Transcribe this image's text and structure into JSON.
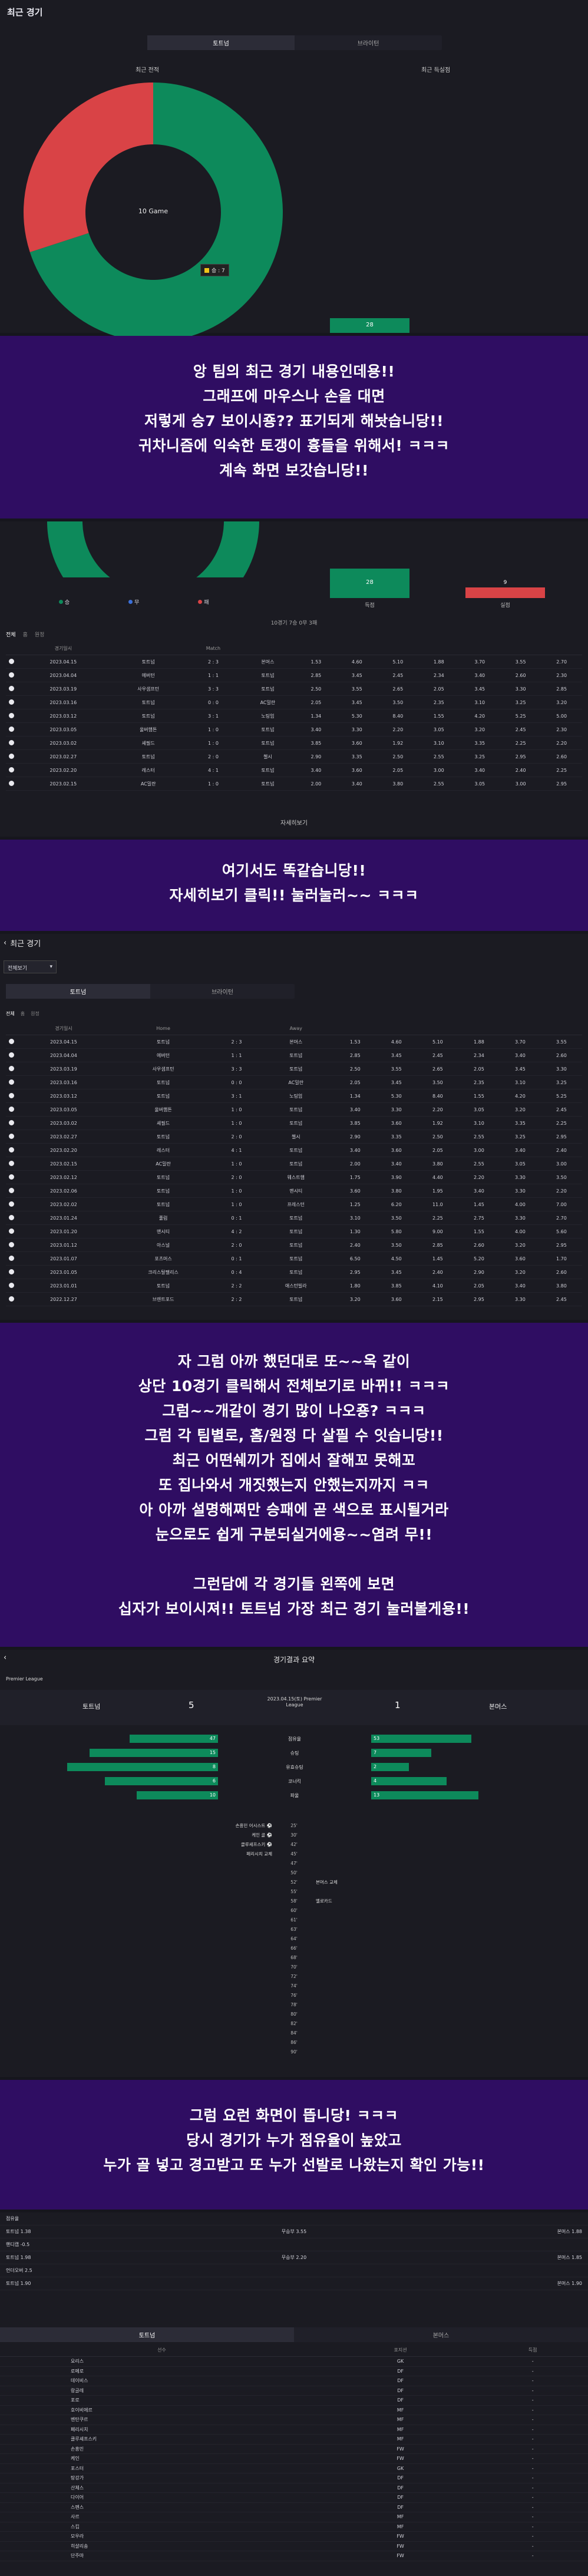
{
  "section1": {
    "title": "최근 경기",
    "tabs": [
      "토트넘",
      "브라이턴"
    ],
    "donut_left_label": "최근 전적",
    "donut_right_label": "최근 득실점",
    "donut_center": "10 Game",
    "legend_chip": "승 : 7",
    "bar_value": "28"
  },
  "chart_data": {
    "type": "pie",
    "categories": [
      "승",
      "패"
    ],
    "values": [
      7,
      3
    ],
    "title": "",
    "center_label": "10 Game",
    "legend_placement": "bottom"
  },
  "colors": {
    "green": "#0d8a5b",
    "red": "#d94346",
    "purple": "#2f0d62",
    "bg": "#16161d"
  },
  "caption1": [
    "앙 팀의 최근 경기 내용인데용!!",
    "그래프에 마우스나 손을 대면",
    "저렇게 승7 보이시죵?? 표기되게 해놧습니당!!",
    "귀차니즘에 익숙한 토갱이 흉들을 위해서! ㅋㅋㅋ",
    "계속 화면 보갓습니당!!"
  ],
  "section2": {
    "legend": [
      "승",
      "무",
      "패"
    ],
    "goals_value": "28",
    "conceded_value": "9",
    "goals_label": "득점",
    "conceded_label": "실점",
    "summary": "10경기 7승 0무 3패",
    "filter": [
      "전체",
      "홈",
      "원정"
    ],
    "headers": [
      "경기일시",
      "",
      "Match",
      "",
      "",
      "",
      "",
      "",
      "",
      "",
      ""
    ],
    "rows": [
      [
        "2023.04.15",
        "토트넘",
        "2 : 3",
        "본머스",
        "1.53",
        "4.60",
        "5.10",
        "1.88",
        "3.70",
        "3.55",
        "2.70"
      ],
      [
        "2023.04.04",
        "에버턴",
        "1 : 1",
        "토트넘",
        "2.85",
        "3.45",
        "2.45",
        "2.34",
        "3.40",
        "2.60",
        "2.30"
      ],
      [
        "2023.03.19",
        "사우샘프턴",
        "3 : 3",
        "토트넘",
        "2.50",
        "3.55",
        "2.65",
        "2.05",
        "3.45",
        "3.30",
        "2.85"
      ],
      [
        "2023.03.16",
        "토트넘",
        "0 : 0",
        "AC밀란",
        "2.05",
        "3.45",
        "3.50",
        "2.35",
        "3.10",
        "3.25",
        "3.20"
      ],
      [
        "2023.03.12",
        "토트넘",
        "3 : 1",
        "노팅엄",
        "1.34",
        "5.30",
        "8.40",
        "1.55",
        "4.20",
        "5.25",
        "5.00"
      ],
      [
        "2023.03.05",
        "울버햄튼",
        "1 : 0",
        "토트넘",
        "3.40",
        "3.30",
        "2.20",
        "3.05",
        "3.20",
        "2.45",
        "2.30"
      ],
      [
        "2023.03.02",
        "셰필드",
        "1 : 0",
        "토트넘",
        "3.85",
        "3.60",
        "1.92",
        "3.10",
        "3.35",
        "2.25",
        "2.20"
      ],
      [
        "2023.02.27",
        "토트넘",
        "2 : 0",
        "첼시",
        "2.90",
        "3.35",
        "2.50",
        "2.55",
        "3.25",
        "2.95",
        "2.60"
      ],
      [
        "2023.02.20",
        "레스터",
        "4 : 1",
        "토트넘",
        "3.40",
        "3.60",
        "2.05",
        "3.00",
        "3.40",
        "2.40",
        "2.25"
      ],
      [
        "2023.02.15",
        "AC밀란",
        "1 : 0",
        "토트넘",
        "2.00",
        "3.40",
        "3.80",
        "2.55",
        "3.05",
        "3.00",
        "2.95"
      ]
    ],
    "more_button": "자세히보기"
  },
  "caption2": [
    "여기서도 똑같습니당!!",
    "자세히보기 클릭!! 눌러눌러~~ ㅋㅋㅋ"
  ],
  "section3": {
    "back_title": "최근 경기",
    "dropdown": "전체보기",
    "tabs": [
      "토트넘",
      "브라이턴"
    ],
    "filter": [
      "전체",
      "홈",
      "원정"
    ],
    "headers": [
      "경기일시",
      "Home",
      "",
      "Away",
      "",
      "",
      "",
      "",
      "",
      ""
    ],
    "rows": [
      [
        "2023.04.15",
        "토트넘",
        "2 : 3",
        "본머스",
        "1.53",
        "4.60",
        "5.10",
        "1.88",
        "3.70",
        "3.55"
      ],
      [
        "2023.04.04",
        "에버턴",
        "1 : 1",
        "토트넘",
        "2.85",
        "3.45",
        "2.45",
        "2.34",
        "3.40",
        "2.60"
      ],
      [
        "2023.03.19",
        "사우샘프턴",
        "3 : 3",
        "토트넘",
        "2.50",
        "3.55",
        "2.65",
        "2.05",
        "3.45",
        "3.30"
      ],
      [
        "2023.03.16",
        "토트넘",
        "0 : 0",
        "AC밀란",
        "2.05",
        "3.45",
        "3.50",
        "2.35",
        "3.10",
        "3.25"
      ],
      [
        "2023.03.12",
        "토트넘",
        "3 : 1",
        "노팅엄",
        "1.34",
        "5.30",
        "8.40",
        "1.55",
        "4.20",
        "5.25"
      ],
      [
        "2023.03.05",
        "울버햄튼",
        "1 : 0",
        "토트넘",
        "3.40",
        "3.30",
        "2.20",
        "3.05",
        "3.20",
        "2.45"
      ],
      [
        "2023.03.02",
        "셰필드",
        "1 : 0",
        "토트넘",
        "3.85",
        "3.60",
        "1.92",
        "3.10",
        "3.35",
        "2.25"
      ],
      [
        "2023.02.27",
        "토트넘",
        "2 : 0",
        "첼시",
        "2.90",
        "3.35",
        "2.50",
        "2.55",
        "3.25",
        "2.95"
      ],
      [
        "2023.02.20",
        "레스터",
        "4 : 1",
        "토트넘",
        "3.40",
        "3.60",
        "2.05",
        "3.00",
        "3.40",
        "2.40"
      ],
      [
        "2023.02.15",
        "AC밀란",
        "1 : 0",
        "토트넘",
        "2.00",
        "3.40",
        "3.80",
        "2.55",
        "3.05",
        "3.00"
      ],
      [
        "2023.02.12",
        "토트넘",
        "2 : 0",
        "웨스트햄",
        "1.75",
        "3.90",
        "4.40",
        "2.20",
        "3.30",
        "3.50"
      ],
      [
        "2023.02.06",
        "토트넘",
        "1 : 0",
        "맨시티",
        "3.60",
        "3.80",
        "1.95",
        "3.40",
        "3.30",
        "2.20"
      ],
      [
        "2023.02.02",
        "토트넘",
        "1 : 0",
        "프레스턴",
        "1.25",
        "6.20",
        "11.0",
        "1.45",
        "4.00",
        "7.00"
      ],
      [
        "2023.01.24",
        "풀럼",
        "0 : 1",
        "토트넘",
        "3.10",
        "3.50",
        "2.25",
        "2.75",
        "3.30",
        "2.70"
      ],
      [
        "2023.01.20",
        "맨시티",
        "4 : 2",
        "토트넘",
        "1.30",
        "5.80",
        "9.00",
        "1.55",
        "4.00",
        "5.60"
      ],
      [
        "2023.01.12",
        "아스널",
        "2 : 0",
        "토트넘",
        "2.40",
        "3.50",
        "2.85",
        "2.60",
        "3.20",
        "2.95"
      ],
      [
        "2023.01.07",
        "포츠머스",
        "0 : 1",
        "토트넘",
        "6.50",
        "4.50",
        "1.45",
        "5.20",
        "3.60",
        "1.70"
      ],
      [
        "2023.01.05",
        "크리스탈팰리스",
        "0 : 4",
        "토트넘",
        "2.95",
        "3.45",
        "2.40",
        "2.90",
        "3.20",
        "2.60"
      ],
      [
        "2023.01.01",
        "토트넘",
        "2 : 2",
        "애스턴빌라",
        "1.80",
        "3.85",
        "4.10",
        "2.05",
        "3.40",
        "3.80"
      ],
      [
        "2022.12.27",
        "브렌트포드",
        "2 : 2",
        "토트넘",
        "3.20",
        "3.60",
        "2.15",
        "2.95",
        "3.30",
        "2.45"
      ]
    ]
  },
  "caption3": [
    "자 그럼 아까 했던대로 또~~옥 같이",
    "상단 10경기 클릭해서 전체보기로 바뀌!! ㅋㅋㅋ",
    "그럼~~개같이 경기 많이 나오죵? ㅋㅋㅋ",
    "그럼 각 팀별로, 홈/원정 다 살필 수 잇습니당!!",
    "최근 어떤쉐끼가 집에서 잘해꼬 못해꼬",
    "또 집나와서 개짓했는지 안했는지까지 ㅋㅋ",
    "아 아까 설명해쩌만 승패에 곧 색으로 표시될거라",
    "눈으로도 쉽게 구분되실거에용~~염려 무!!",
    "",
    "그런담에 각 경기들 왼쪽에 보면",
    "십자가 보이시져!! 토트넘 가장 최근 경기 눌러볼게용!!"
  ],
  "section4": {
    "title": "경기결과 요약",
    "league": "Premier League",
    "home_team": "토트넘",
    "away_team": "본머스",
    "home_score": "5",
    "away_score": "1",
    "match_info": "2023.04.15(토) Premier League",
    "stats": [
      {
        "label": "점유율",
        "home": "47",
        "away": "53",
        "home_frac": 0.47
      },
      {
        "label": "슈팅",
        "home": "15",
        "away": "7",
        "home_frac": 0.68
      },
      {
        "label": "유효슈팅",
        "home": "8",
        "away": "2",
        "home_frac": 0.8
      },
      {
        "label": "코너킥",
        "home": "6",
        "away": "4",
        "home_frac": 0.6
      },
      {
        "label": "파울",
        "home": "10",
        "away": "13",
        "home_frac": 0.43
      }
    ],
    "timeline_left": [
      "손흥민 어시스트 ⚽",
      "케인 골 ⚽",
      "클루셰프스키 ⚽",
      "페리시치 교체",
      "",
      "",
      "",
      "",
      "",
      "",
      "",
      "",
      "",
      "",
      "",
      "",
      "",
      "",
      "",
      "",
      "",
      "",
      "",
      "",
      ""
    ],
    "timeline_minutes": [
      "25'",
      "30'",
      "42'",
      "45'",
      "47'",
      "50'",
      "52'",
      "55'",
      "58'",
      "60'",
      "61'",
      "63'",
      "64'",
      "66'",
      "68'",
      "70'",
      "72'",
      "74'",
      "76'",
      "78'",
      "80'",
      "82'",
      "84'",
      "86'",
      "90'"
    ],
    "timeline_right": [
      "",
      "",
      "",
      "",
      "",
      "",
      "본머스 교체",
      "",
      "옐로카드",
      "",
      "",
      "",
      "",
      "",
      "",
      "",
      "",
      "",
      "",
      "",
      "",
      "",
      "",
      "",
      ""
    ]
  },
  "caption4": [
    "그럼 요런 화면이 뜹니당! ㅋㅋㅋ",
    "당시 경기가 누가 점유율이 높았고",
    "누가 골 넣고 경고받고 또 누가 선발로 나왔는지 확인 가능!!"
  ],
  "section5": {
    "summary_rows": [
      {
        "left": "점유율",
        "mid": "",
        "right": ""
      },
      {
        "left": "토트넘 1.38",
        "mid": "무승부 3.55",
        "right": "본머스 1.88"
      },
      {
        "left": "핸디캡 -0.5",
        "mid": "",
        "right": ""
      },
      {
        "left": "토트넘 1.98",
        "mid": "무승부 2.20",
        "right": "본머스 1.85"
      },
      {
        "left": "언더오버 2.5",
        "mid": "",
        "right": ""
      },
      {
        "left": "토트넘 1.90",
        "mid": "",
        "right": "본머스 1.90"
      }
    ],
    "tabs": [
      "토트넘",
      "본머스"
    ],
    "lineup_headers": [
      "선수",
      "포지션",
      "득점"
    ],
    "lineup": [
      [
        "요리스",
        "GK",
        "-"
      ],
      [
        "로메로",
        "DF",
        "-"
      ],
      [
        "데이비스",
        "DF",
        "-"
      ],
      [
        "랑글레",
        "DF",
        "-"
      ],
      [
        "포로",
        "DF",
        "-"
      ],
      [
        "호이비에르",
        "MF",
        "-"
      ],
      [
        "벤탄쿠르",
        "MF",
        "-"
      ],
      [
        "페리시치",
        "MF",
        "-"
      ],
      [
        "클루셰프스키",
        "MF",
        "-"
      ],
      [
        "손흥민",
        "FW",
        "-"
      ],
      [
        "케인",
        "FW",
        "-"
      ],
      [
        "포스터",
        "GK",
        "-"
      ],
      [
        "탕강가",
        "DF",
        "-"
      ],
      [
        "산체스",
        "DF",
        "-"
      ],
      [
        "다이어",
        "DF",
        "-"
      ],
      [
        "스펜스",
        "DF",
        "-"
      ],
      [
        "사르",
        "MF",
        "-"
      ],
      [
        "스킵",
        "MF",
        "-"
      ],
      [
        "모우라",
        "FW",
        "-"
      ],
      [
        "히샬리송",
        "FW",
        "-"
      ],
      [
        "단주마",
        "FW",
        "-"
      ]
    ]
  }
}
